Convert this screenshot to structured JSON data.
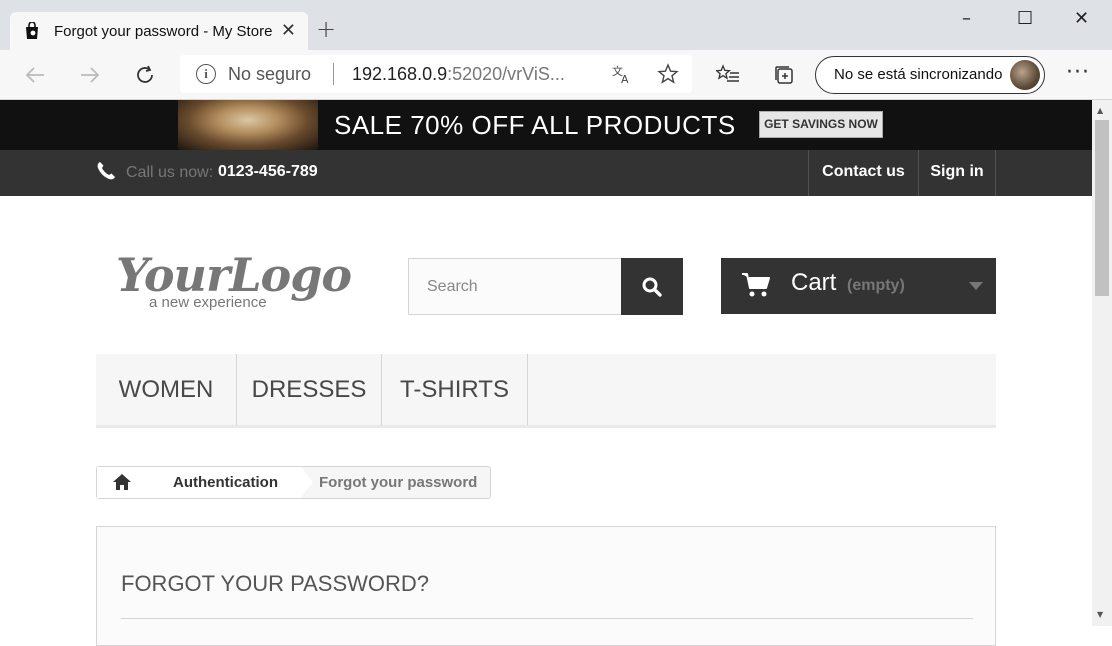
{
  "browser": {
    "tab": {
      "title": "Forgot your password - My Store"
    },
    "new_tab_symbol": "+",
    "window_controls": {
      "minimize": "–",
      "maximize": "☐",
      "close": "✕"
    },
    "address": {
      "security_label": "No seguro",
      "url_host": "192.168.0.9",
      "url_rest": ":52020/vrViS..."
    },
    "sync_label": "No se está sincronizando",
    "more_symbol": "···"
  },
  "banner": {
    "text": "SALE 70% OFF ALL PRODUCTS",
    "button": "GET SAVINGS NOW"
  },
  "topnav": {
    "call_label": "Call us now:",
    "phone": "0123-456-789",
    "contact": "Contact us",
    "signin": "Sign in"
  },
  "logo": {
    "main": "YourLogo",
    "tagline": "a new experience"
  },
  "search": {
    "placeholder": "Search"
  },
  "cart": {
    "label": "Cart",
    "status": "(empty)"
  },
  "menu": {
    "items": [
      {
        "label": "WOMEN"
      },
      {
        "label": "DRESSES"
      },
      {
        "label": "T-SHIRTS"
      }
    ]
  },
  "breadcrumb": {
    "parent": "Authentication",
    "current": "Forgot your password"
  },
  "page": {
    "title": "FORGOT YOUR PASSWORD?"
  },
  "colors": {
    "accent_dark": "#333333",
    "banner_bg": "#111111",
    "menu_bg": "#f6f6f6"
  }
}
